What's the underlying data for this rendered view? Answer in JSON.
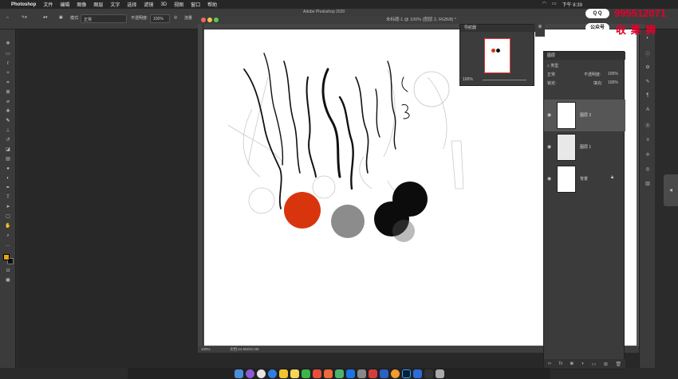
{
  "menubar": {
    "app_name": "Photoshop",
    "items": [
      "文件",
      "编辑",
      "图像",
      "图层",
      "文字",
      "选择",
      "滤镜",
      "3D",
      "视图",
      "窗口",
      "帮助"
    ],
    "clock": "下午 8:39"
  },
  "options_bar": {
    "mode_label": "模式:",
    "mode_value": "正常",
    "opacity_label": "不透明度:",
    "opacity_value": "100%",
    "flow_label": "流量"
  },
  "app_window_title": "Adobe Photoshop 2020",
  "document": {
    "tab_title": "未标题-1 @ 100% (图层 2, RGB/8) *",
    "zoom": "100%",
    "doc_info": "文档:24.9M/32.0M"
  },
  "navigator": {
    "tab_label": "导航器",
    "zoom": "100%"
  },
  "layers_panel": {
    "tab_label": "图层",
    "filter_label": "类型",
    "blend_mode": "正常",
    "opacity_label": "不透明度:",
    "opacity_value": "100%",
    "lock_label": "锁定:",
    "fill_label": "填充:",
    "fill_value": "100%",
    "layers": [
      {
        "name": "图层 2",
        "active": true,
        "locked": false
      },
      {
        "name": "图层 1",
        "active": false,
        "locked": false
      },
      {
        "name": "背景",
        "active": false,
        "locked": true
      }
    ]
  },
  "watermark": {
    "qq_badge": "Q Q",
    "qq_number": "995512071",
    "wechat_badge": "公众号",
    "wechat_text": "收 集 狮"
  },
  "colors": {
    "foreground": "#e4a21c",
    "background": "#111111",
    "red_swatch": "#d8350f",
    "gray_swatch": "#8c8c8c"
  },
  "icons": {
    "tools": [
      "move-icon",
      "marquee-icon",
      "lasso-icon",
      "magic-wand-icon",
      "crop-icon",
      "frame-icon",
      "eyedropper-icon",
      "healing-icon",
      "brush-icon",
      "stamp-icon",
      "history-brush-icon",
      "eraser-icon",
      "gradient-icon",
      "blur-icon",
      "dodge-icon",
      "pen-icon",
      "type-icon",
      "path-select-icon",
      "rectangle-icon",
      "hand-icon",
      "zoom-icon"
    ]
  }
}
